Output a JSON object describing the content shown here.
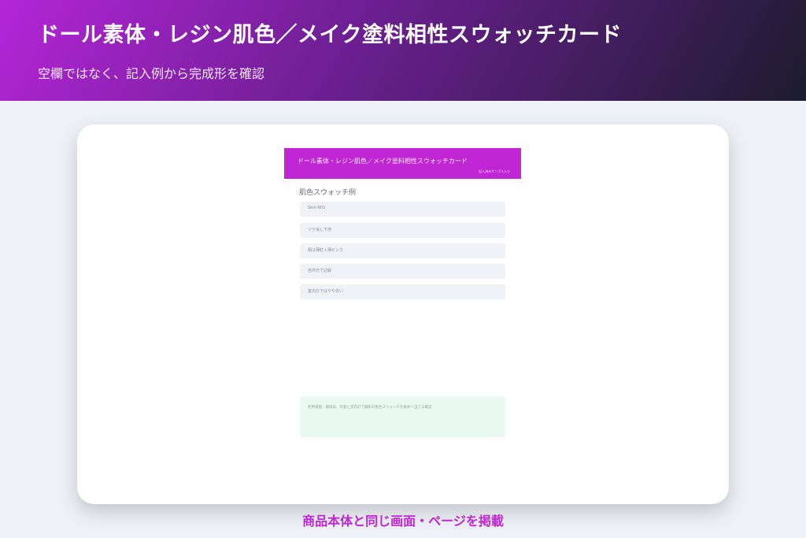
{
  "hero": {
    "title": "ドール素体・レジン肌色／メイク塗料相性スウォッチカード",
    "subtitle": "空欄ではなく、記入例から完成形を確認"
  },
  "preview": {
    "doc_title": "ドール素体・レジン肌色／メイク塗料相性スウォッチカード",
    "doc_subtitle": "記入済みサンプル入り",
    "section_title": "肌色スウォッチ例",
    "fields": [
      "Skin-N01",
      "ツヤ消し下地",
      "頬は薄紅＋薄ピンク",
      "自然光で記録",
      "室内灯ではやや赤い"
    ],
    "note": "利用場面：補修前、到着と室内灯で撮影の肌色スウォッチを素体へ当てる確認"
  },
  "footer": {
    "caption": "商品本体と同じ画面・ページを掲載"
  },
  "colors": {
    "accent": "#c026d3",
    "hero_start": "#b425d8",
    "hero_end": "#1c1c2e",
    "background": "#eef1f6",
    "field_bg": "#f0f2f8",
    "note_bg": "#eafaf2"
  }
}
